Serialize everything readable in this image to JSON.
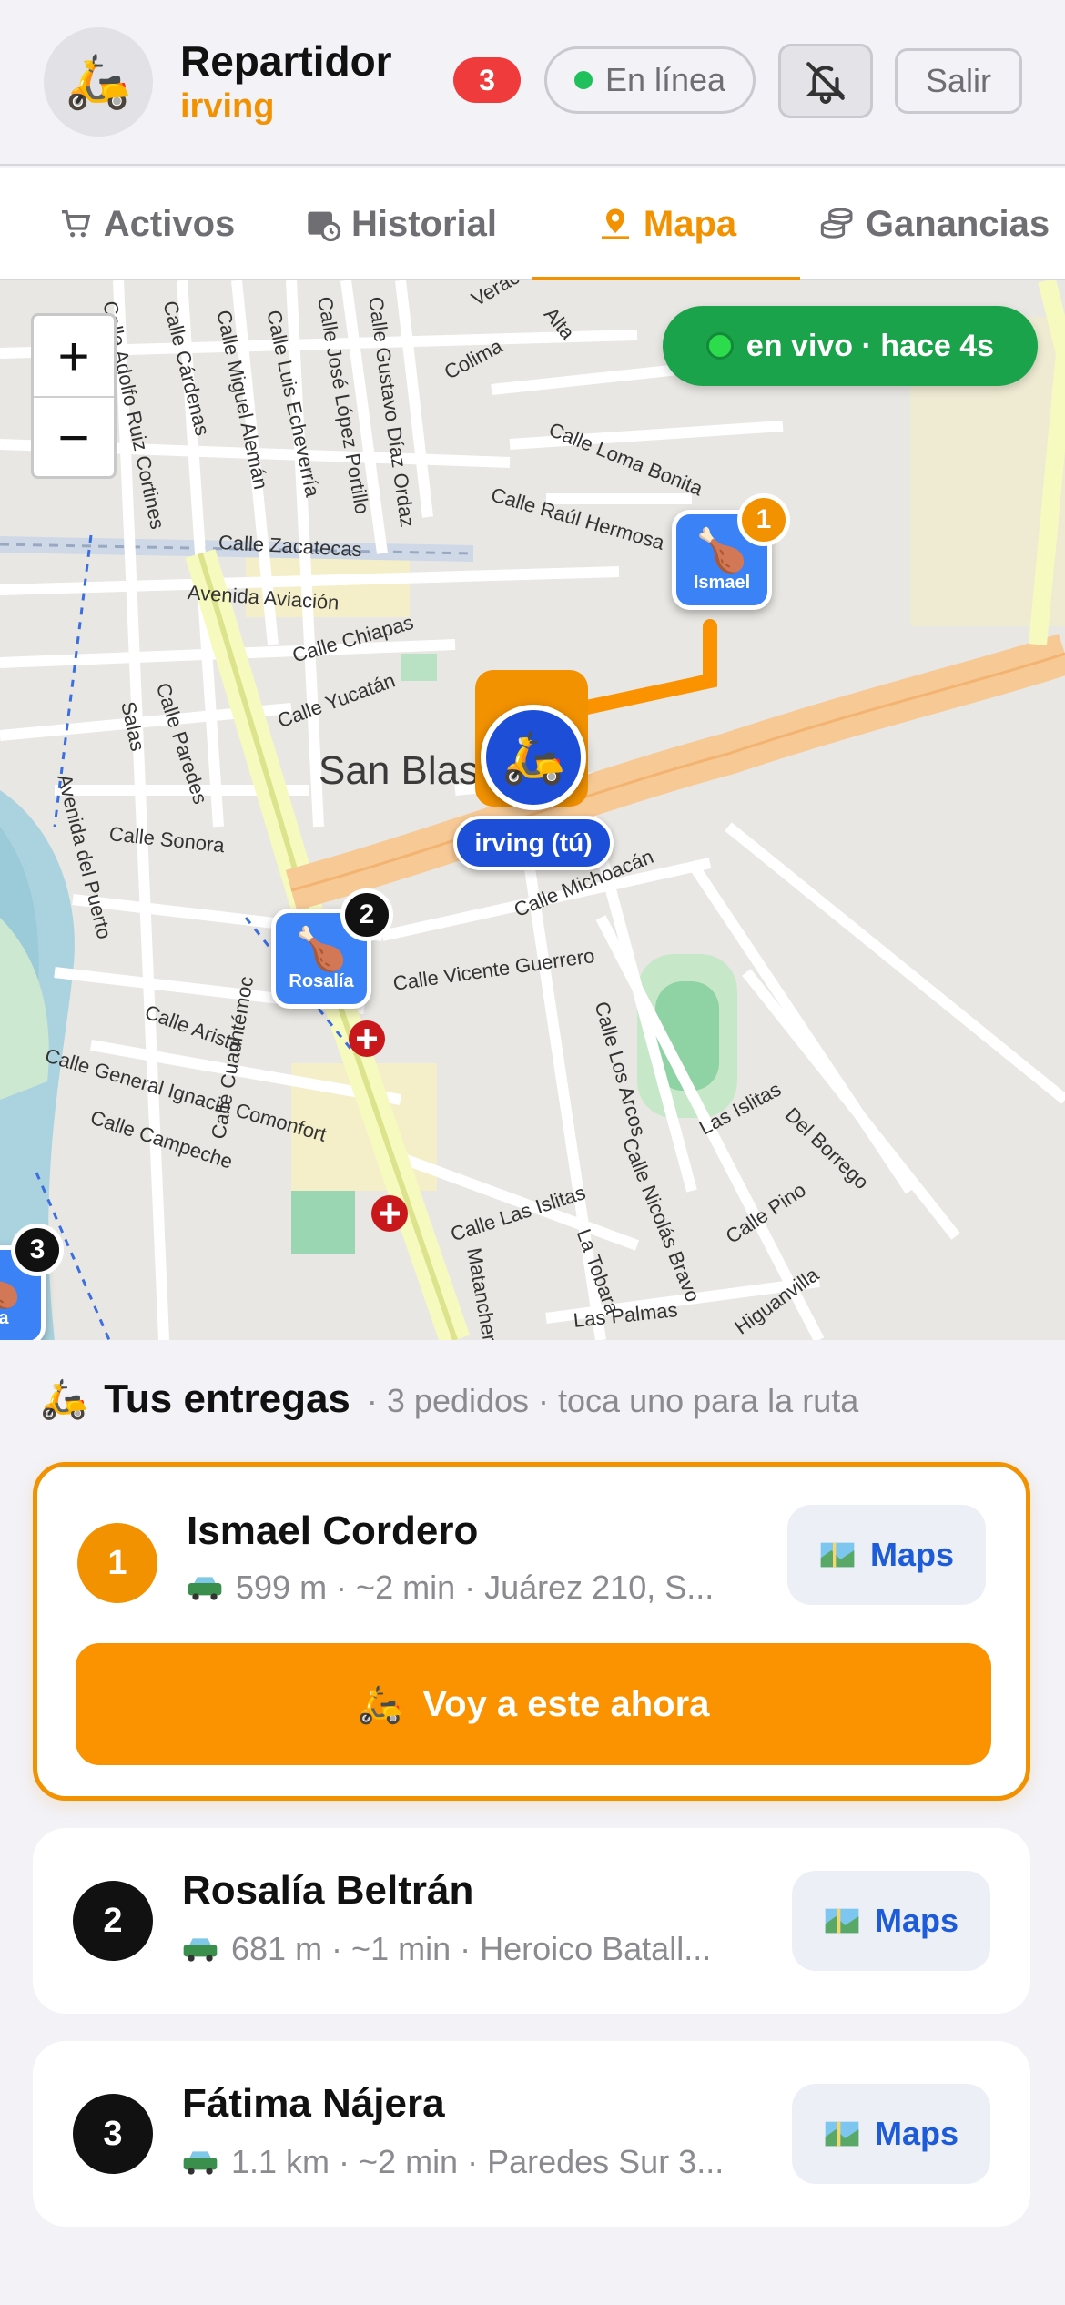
{
  "header": {
    "avatar_emoji": "🛵",
    "role": "Repartidor",
    "username": "irving",
    "notification_count": "3",
    "status_label": "En línea",
    "logout_label": "Salir"
  },
  "tabs": [
    {
      "label": "Activos",
      "icon": "cart-icon",
      "active": false
    },
    {
      "label": "Historial",
      "icon": "calendar-clock-icon",
      "active": false
    },
    {
      "label": "Mapa",
      "icon": "map-pin-icon",
      "active": true
    },
    {
      "label": "Ganancias",
      "icon": "coins-icon",
      "active": false
    }
  ],
  "map": {
    "zoom_in": "+",
    "zoom_out": "−",
    "live_status": "en vivo · hace 4s",
    "me_label": "irving (tú)",
    "me_emoji": "🛵",
    "pin_emoji": "🍗",
    "pins": [
      {
        "number": "1",
        "label": "Ismael"
      },
      {
        "number": "2",
        "label": "Rosalía"
      },
      {
        "number": "3",
        "label": "ma"
      }
    ],
    "area_label": "San Blas",
    "streets": [
      "Calle Adolfo Ruiz Cortines",
      "Calle Cárdenas",
      "Calle Miguel Alemán",
      "Calle Luis Echeverría",
      "Calle José López Portillo",
      "Calle Gustavo Díaz Ordaz",
      "Veracruz",
      "Colima",
      "Alta",
      "Calle Loma Bonita",
      "Calle Raúl Hermosa",
      "Calle Zacatecas",
      "Avenida Aviación",
      "Calle Chiapas",
      "Calle Yucatán",
      "Calle Paredes",
      "Salas",
      "Avenida del Puerto",
      "Calle Sonora",
      "Calle Michoacán",
      "Calle Vicente Guerrero",
      "Calle Arista",
      "Calle General Ignacio Comonfort",
      "Calle Campeche",
      "Calle Cuauhtémoc",
      "Calle Las Islitas",
      "Calle Los Arcos",
      "Las Islitas",
      "Del Borrego",
      "Calle Pino",
      "Calle Nicolás Bravo",
      "La Tobara",
      "Matanchen",
      "Las Palmas",
      "Higuanvilla",
      "Calle Paredes",
      "Calle Zacatecas"
    ]
  },
  "deliveries": {
    "emoji": "🛵",
    "title": "Tus entregas",
    "subtitle": "· 3 pedidos · toca uno para la ruta",
    "maps_label": "Maps",
    "go_label": "Voy a este ahora",
    "items": [
      {
        "number": "1",
        "name": "Ismael Cordero",
        "info": "599 m · ~2 min · Juárez 210, S...",
        "selected": true
      },
      {
        "number": "2",
        "name": "Rosalía Beltrán",
        "info": "681 m · ~1 min · Heroico Batall...",
        "selected": false
      },
      {
        "number": "3",
        "name": "Fátima Nájera",
        "info": "1.1 km · ~2 min · Paredes Sur 3...",
        "selected": false
      }
    ]
  },
  "colors": {
    "accent": "#f39200",
    "selected_number": "#f39200",
    "default_number": "#111111",
    "online": "#20c05c",
    "live": "#1aa34a",
    "pin": "#3b82f6",
    "me": "#1d4ed8",
    "badge": "#ef3b3b"
  }
}
